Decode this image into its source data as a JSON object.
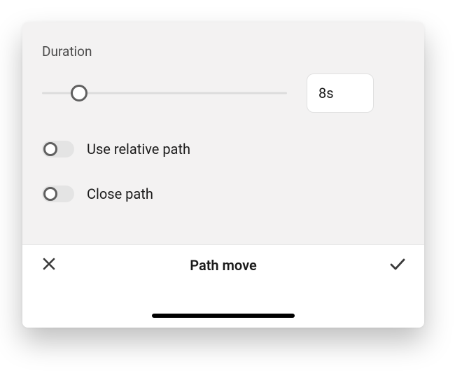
{
  "duration": {
    "label": "Duration",
    "value_display": "8s",
    "slider_position_pct": 15
  },
  "toggles": {
    "relative": {
      "label": "Use relative path",
      "on": false
    },
    "close": {
      "label": "Close path",
      "on": false
    }
  },
  "footer": {
    "title": "Path move"
  }
}
